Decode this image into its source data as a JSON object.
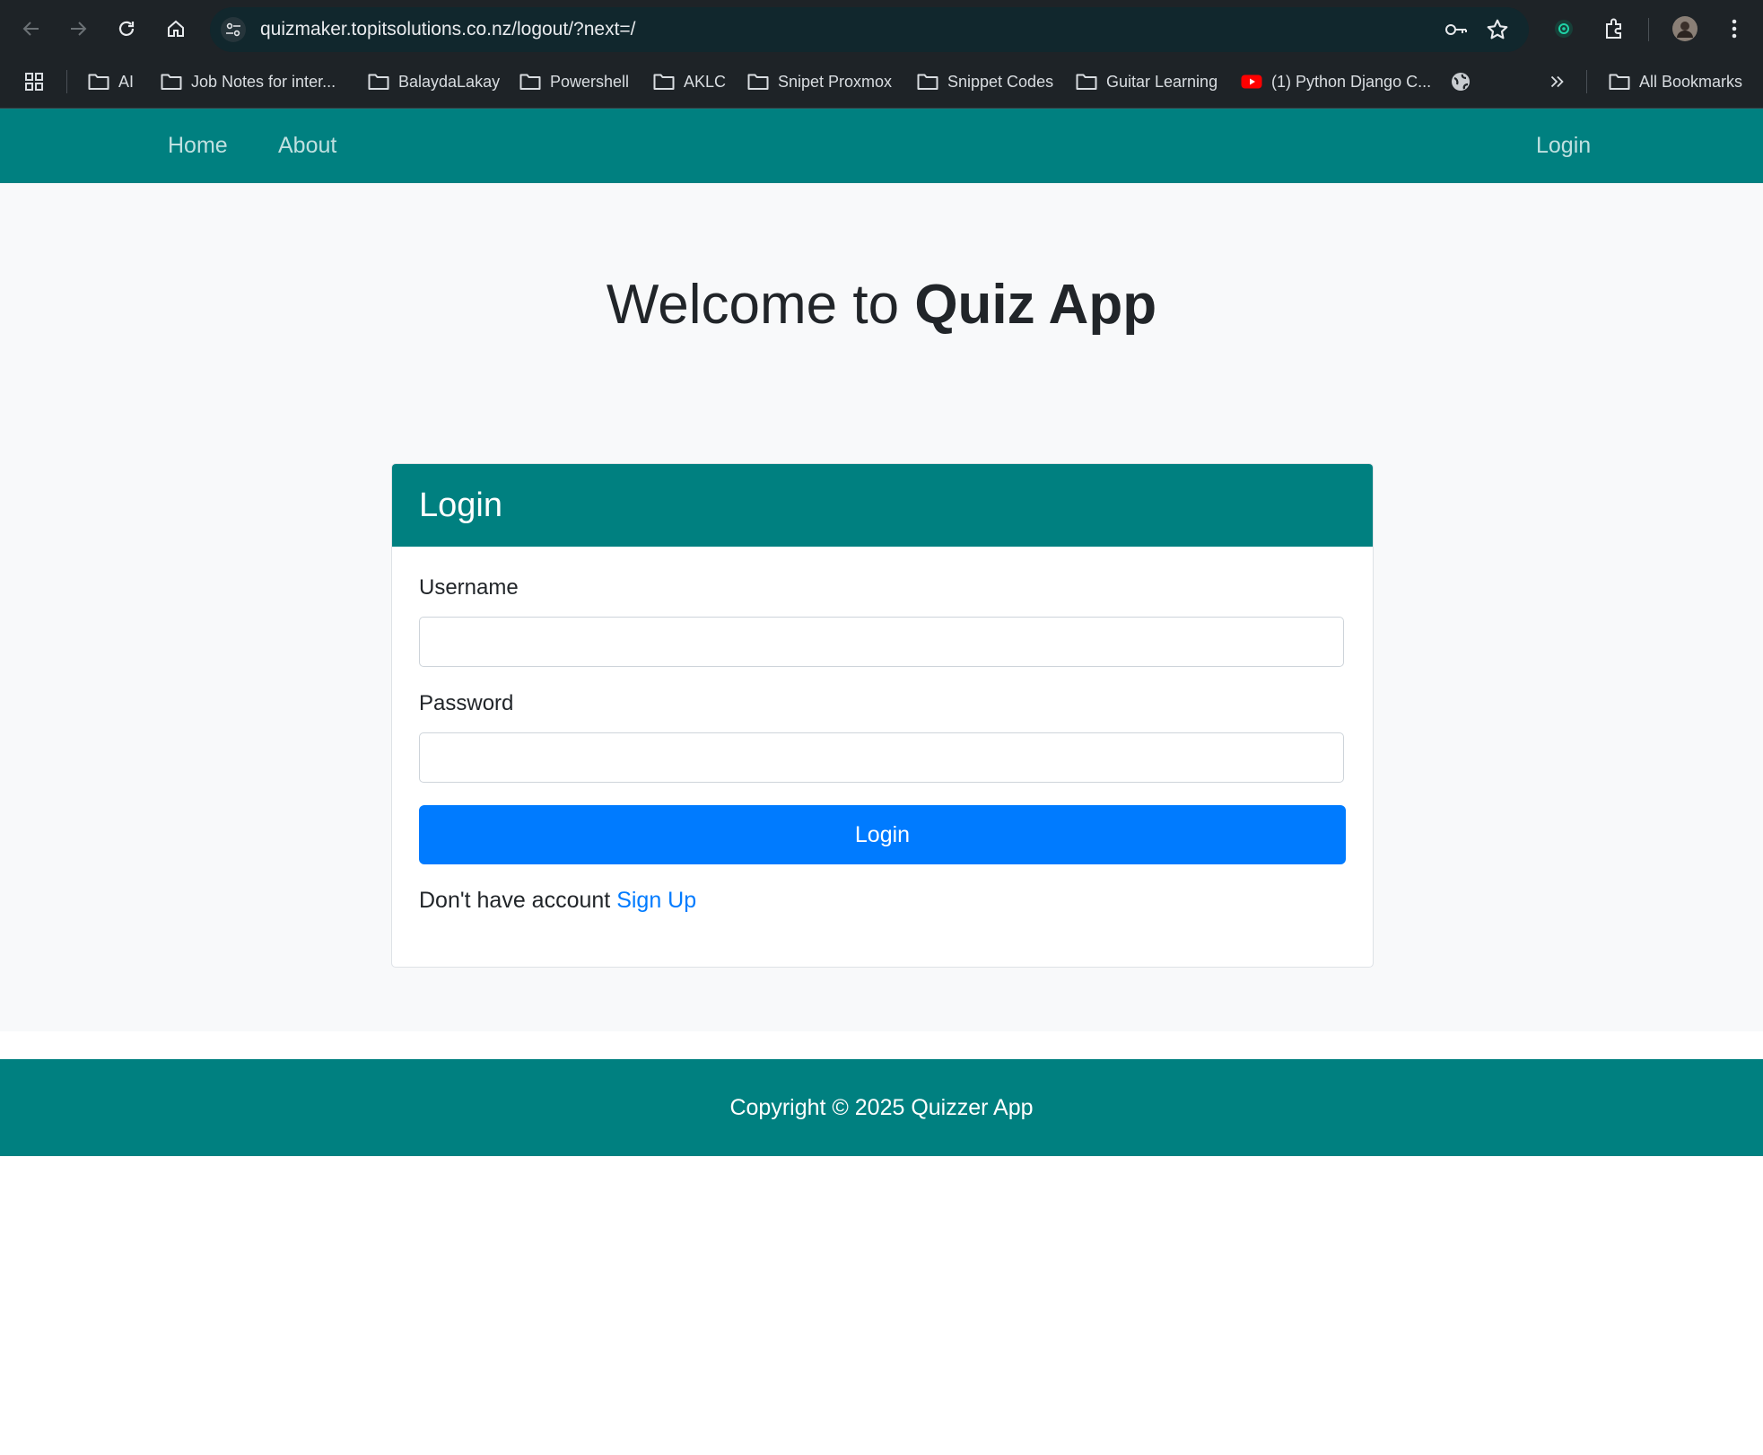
{
  "browser": {
    "url": "quizmaker.topitsolutions.co.nz/logout/?next=/",
    "bookmarks": [
      {
        "label": "AI",
        "icon": "folder-icon"
      },
      {
        "label": "Job Notes for inter...",
        "icon": "folder-icon"
      },
      {
        "label": "BalaydaLakay",
        "icon": "folder-icon"
      },
      {
        "label": "Powershell",
        "icon": "folder-icon"
      },
      {
        "label": "AKLC",
        "icon": "folder-icon"
      },
      {
        "label": "Snipet Proxmox",
        "icon": "folder-icon"
      },
      {
        "label": "Snippet Codes",
        "icon": "folder-icon"
      },
      {
        "label": "Guitar Learning",
        "icon": "folder-icon"
      },
      {
        "label": "(1) Python Django C...",
        "icon": "youtube-icon"
      }
    ],
    "all_bookmarks_label": "All Bookmarks"
  },
  "site_nav": {
    "home_label": "Home",
    "about_label": "About",
    "login_label": "Login"
  },
  "hero": {
    "welcome_prefix": "Welcome to ",
    "app_name": "Quiz App"
  },
  "login_card": {
    "title": "Login",
    "username_label": "Username",
    "username_value": "",
    "password_label": "Password",
    "password_value": "",
    "submit_label": "Login",
    "signup_prompt": "Don't have account ",
    "signup_link": "Sign Up"
  },
  "footer": {
    "copyright": "Copyright © 2025 Quizzer App"
  },
  "colors": {
    "brand_teal": "#008080",
    "primary_button": "#007bff",
    "hero_background": "#f8f9fa"
  }
}
